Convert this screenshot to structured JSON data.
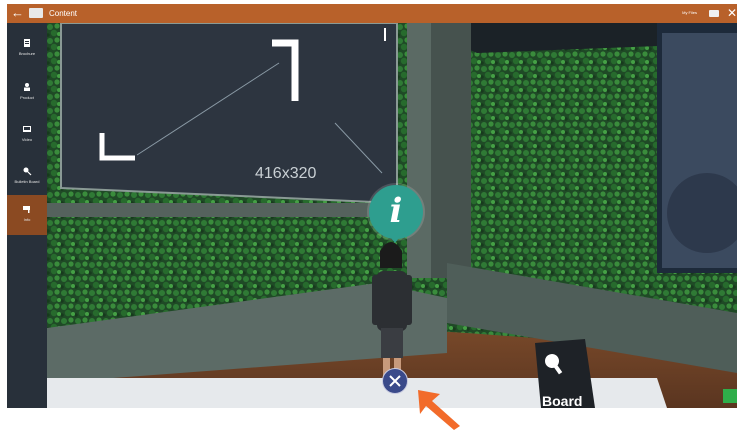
{
  "topbar": {
    "back_icon": "arrow-left-icon",
    "title": "Content",
    "my_files_label": "My Files",
    "close_icon": "close-icon"
  },
  "sidebar": {
    "items": [
      {
        "label": "Brochure",
        "icon": "brochure-icon",
        "active": false
      },
      {
        "label": "Product",
        "icon": "product-icon",
        "active": false
      },
      {
        "label": "Video",
        "icon": "video-icon",
        "active": false
      },
      {
        "label": "Bulletin Board",
        "icon": "pin-icon",
        "active": false
      },
      {
        "label": "Info",
        "icon": "info-flag-icon",
        "active": true
      }
    ]
  },
  "scene": {
    "panel_size_label": "416x320",
    "info_bubble_icon": "info-icon",
    "tool_button_icon": "crossed-tools-icon",
    "board_sign_label": "Board"
  },
  "colors": {
    "topbar": "#b8612a",
    "sidebar": "#28303a",
    "sidebar_active": "#8b4a22",
    "info_bubble": "#2e9e8f",
    "pointer": "#f26b2a"
  }
}
